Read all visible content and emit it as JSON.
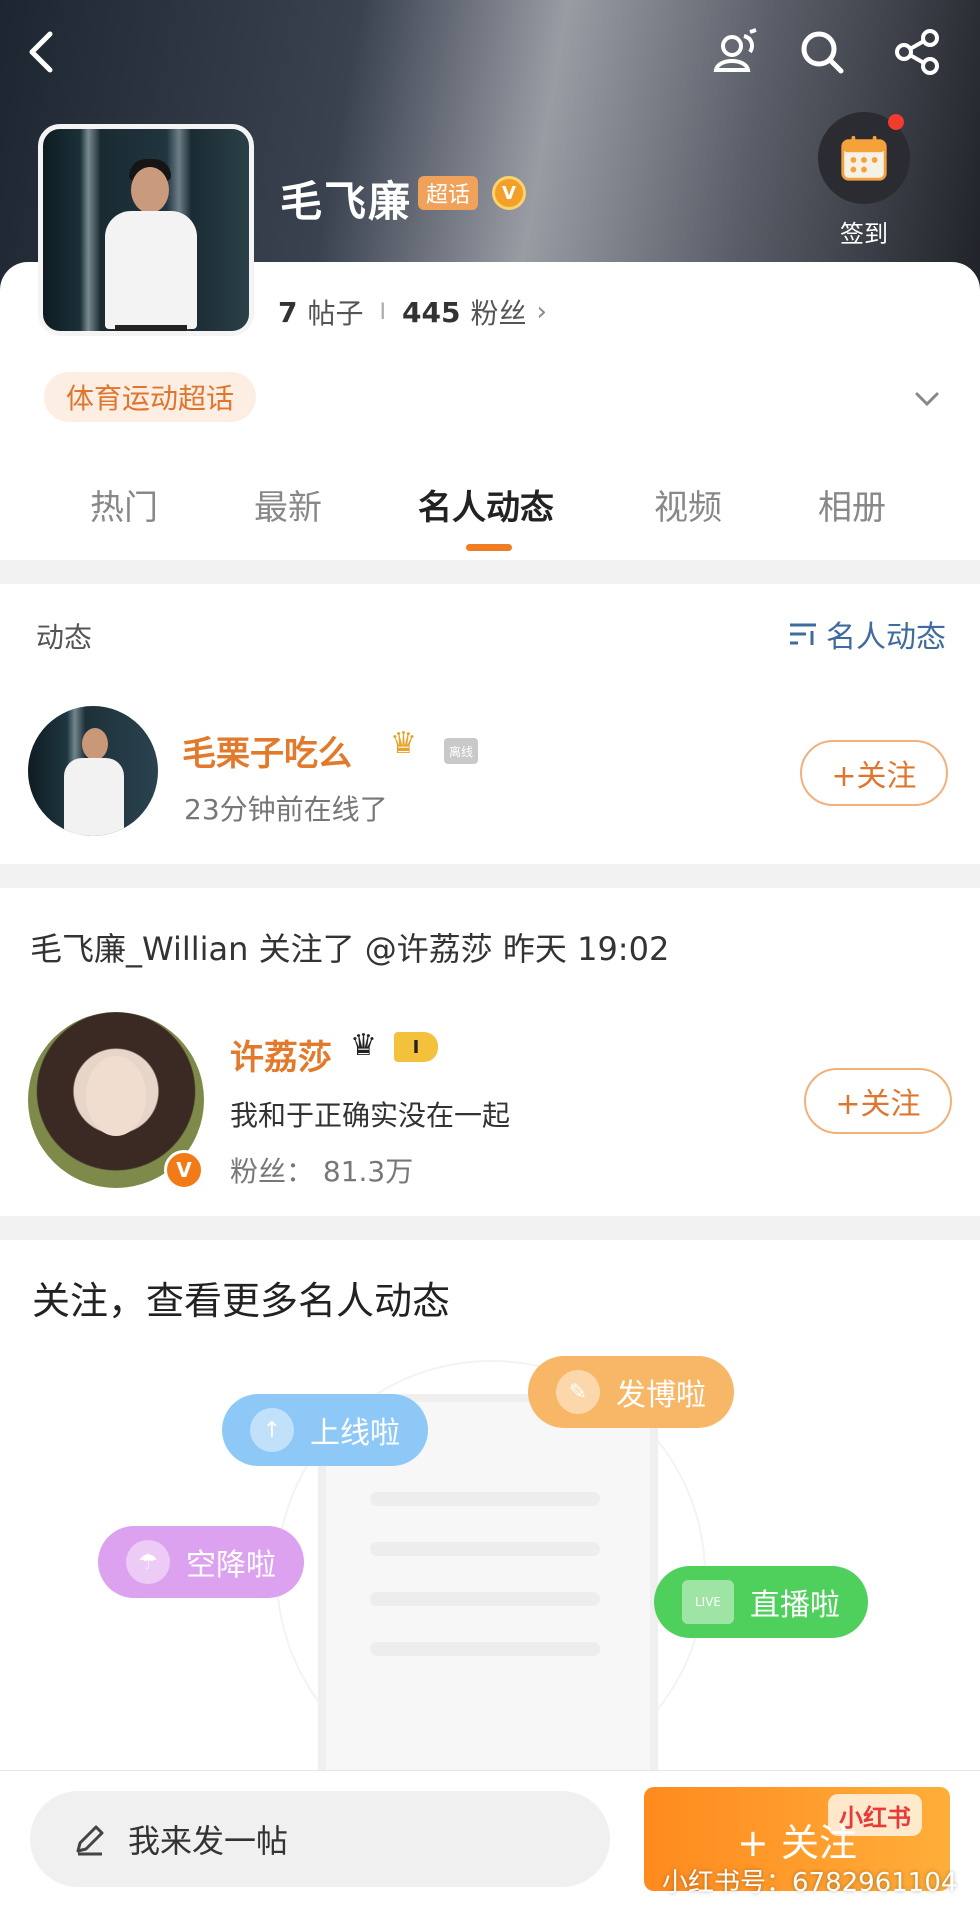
{
  "header": {
    "title": "毛飞廉",
    "super_badge": "超话",
    "verified_badge": "V",
    "signin_label": "签到",
    "stats": {
      "posts_count": "7",
      "posts_label": "帖子",
      "sep": "I",
      "fans_count": "445",
      "fans_label": "粉丝"
    },
    "category_tag": "体育运动超话"
  },
  "tabs": [
    "热门",
    "最新",
    "名人动态",
    "视频",
    "相册"
  ],
  "active_tab_index": 2,
  "dynamic_section": {
    "label": "动态",
    "filter_label": "名人动态",
    "user": {
      "name": "毛栗子吃么",
      "status_tag": "离线",
      "online_text": "23分钟前在线了",
      "follow_label": "+关注"
    }
  },
  "activity": {
    "text": "毛飞廉_Willian 关注了 @许荔莎 昨天 19:02",
    "user": {
      "name": "许荔莎",
      "level": "I",
      "bio": "我和于正确实没在一起",
      "fans": "粉丝： 81.3万",
      "verified": "V",
      "follow_label": "+关注"
    }
  },
  "promo": {
    "title": "关注，查看更多名人动态",
    "pills": [
      {
        "label": "上线啦",
        "color": "#8ec8f6",
        "icon": "↑"
      },
      {
        "label": "发博啦",
        "color": "#f8b667",
        "icon": "✎"
      },
      {
        "label": "空降啦",
        "color": "#dca1ef",
        "icon": "☂"
      },
      {
        "label": "直播啦",
        "color": "#4fcf5c",
        "icon": "LIVE"
      }
    ]
  },
  "bottom": {
    "compose_placeholder": "我来发一帖",
    "follow_label": "+ 关注"
  },
  "watermark": {
    "logo": "小红书",
    "text": "小红书号：6782961104"
  },
  "colors": {
    "accent": "#f07d21",
    "link_blue": "#3f6b9e"
  }
}
